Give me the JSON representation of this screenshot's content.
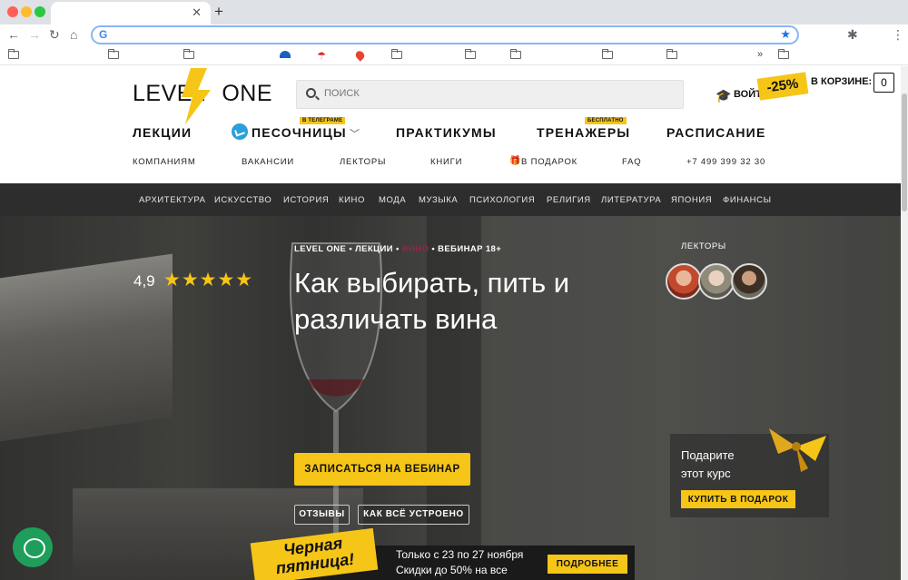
{
  "site": {
    "logo_left": "LEVEL",
    "logo_right": "ONE",
    "search_placeholder": "ПОИСК",
    "login": "ВОЙТИ",
    "discount": "-25%",
    "cart_label": "В КОРЗИНЕ:",
    "cart_count": "0"
  },
  "mainnav": {
    "lectures": "ЛЕКЦИИ",
    "sandboxes": "ПЕСОЧНИЦЫ",
    "sandboxes_tag": "В ТЕЛЕГРАМЕ",
    "practicums": "ПРАКТИКУМЫ",
    "trainers": "ТРЕНАЖЕРЫ",
    "trainers_tag": "БЕСПЛАТНО",
    "schedule": "РАСПИСАНИЕ"
  },
  "subnav": {
    "companies": "КОМПАНИЯМ",
    "vacancies": "ВАКАНСИИ",
    "lecturers": "ЛЕКТОРЫ",
    "books": "КНИГИ",
    "gift": "В ПОДАРОК",
    "faq": "FAQ",
    "phone": "+7 499 399 32 30"
  },
  "categories": [
    "АРХИТЕКТУРА",
    "ИСКУССТВО",
    "ИСТОРИЯ",
    "КИНО",
    "МОДА",
    "МУЗЫКА",
    "ПСИХОЛОГИЯ",
    "РЕЛИГИЯ",
    "ЛИТЕРАТУРА",
    "ЯПОНИЯ",
    "ФИНАНСЫ"
  ],
  "hero": {
    "rating": "4,9",
    "stars": "★★★★★",
    "crumb_1": "LEVEL ONE",
    "crumb_sep": "•",
    "crumb_2": "ЛЕКЦИИ",
    "crumb_3": "ВИНО",
    "crumb_4": "ВЕБИНАР 18+",
    "title": "Как выбирать, пить и различать вина",
    "lectors_label": "ЛЕКТОРЫ",
    "cta": "ЗАПИСАТЬСЯ НА ВЕБИНАР",
    "reviews": "ОТЗЫВЫ",
    "how": "КАК ВСЁ УСТРОЕНО"
  },
  "gift": {
    "line1": "Подарите",
    "line2": "этот курс",
    "button": "КУПИТЬ В ПОДАРОК"
  },
  "promo": {
    "badge_line1": "Черная",
    "badge_line2": "пятница!",
    "text_line1": "Только с 23 по 27 ноября",
    "text_line2": "Скидки до 50% на все",
    "button": "ПОДРОБНЕЕ"
  },
  "colors": {
    "accent": "#f5c518",
    "dark_bar": "#2d2d2d",
    "telegram": "#2aa0da",
    "chat": "#1e9e5a"
  }
}
